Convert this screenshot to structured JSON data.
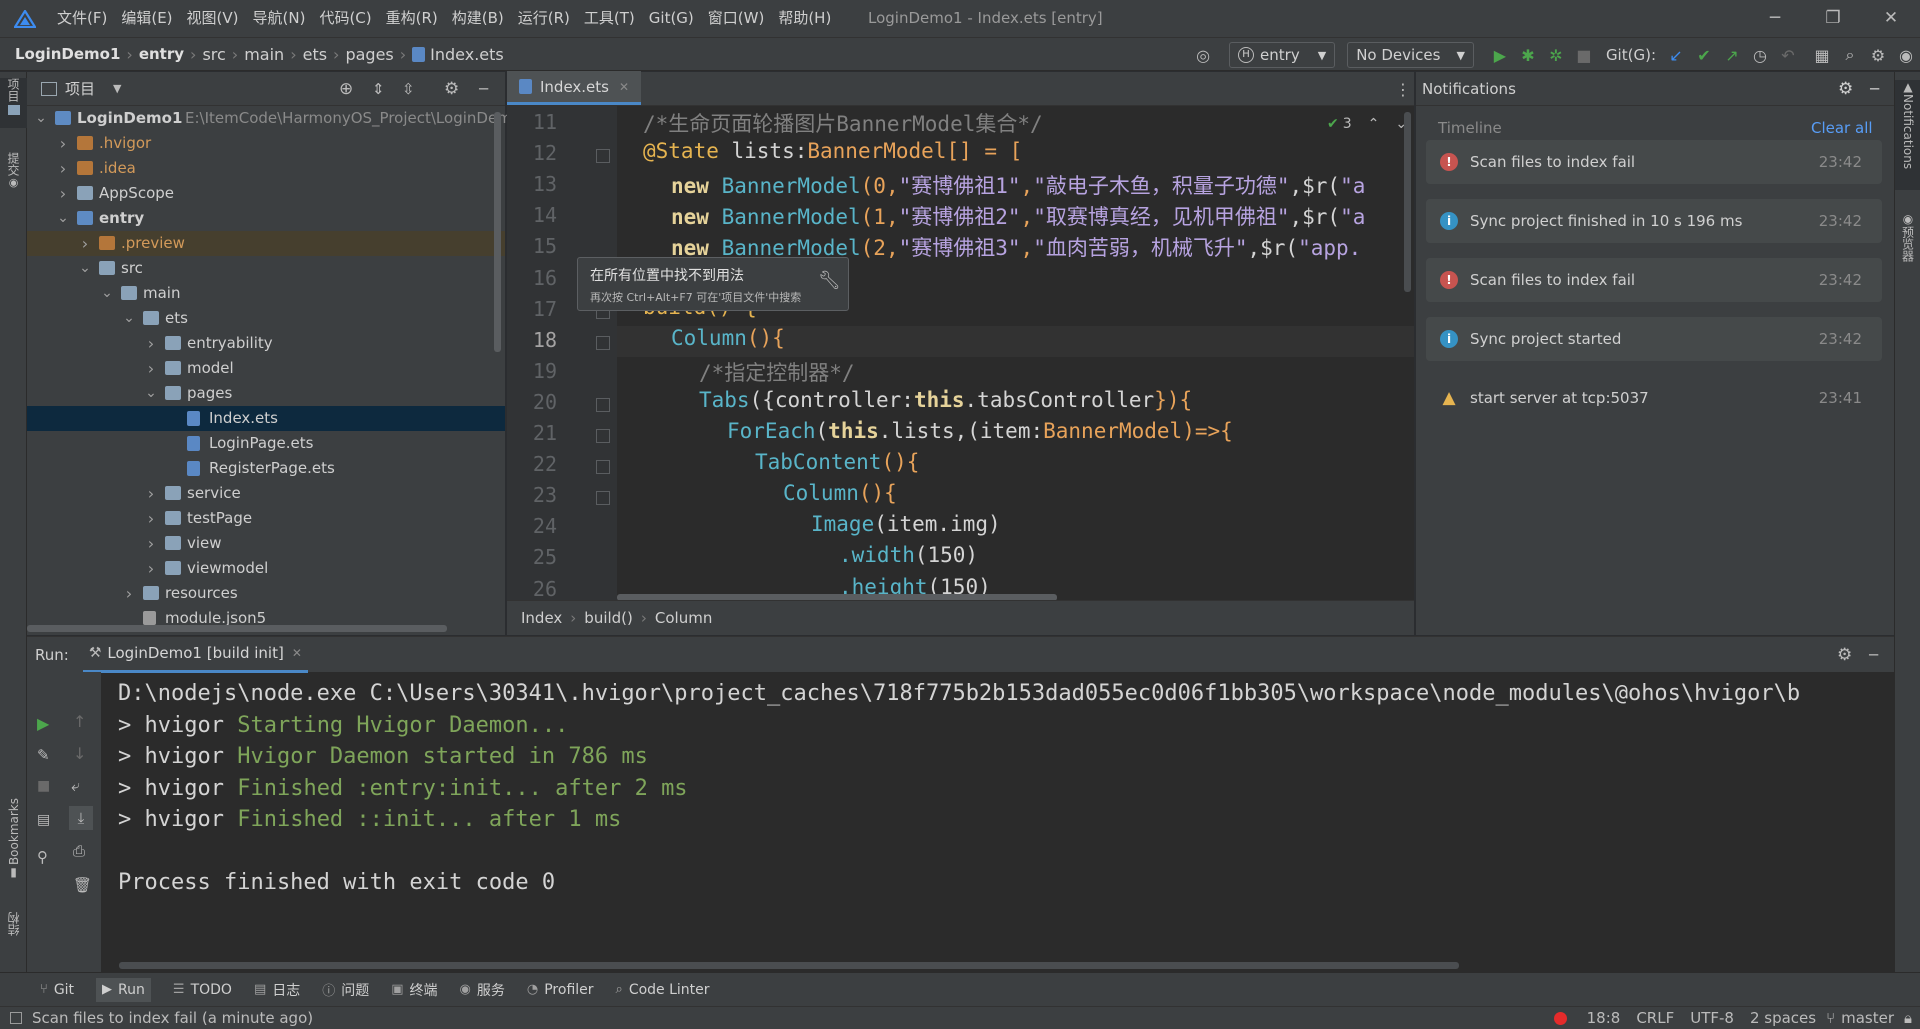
{
  "window": {
    "menu": [
      "文件(F)",
      "编辑(E)",
      "视图(V)",
      "导航(N)",
      "代码(C)",
      "重构(R)",
      "构建(B)",
      "运行(R)",
      "工具(T)",
      "Git(G)",
      "窗口(W)",
      "帮助(H)"
    ],
    "title": "LoginDemo1 - Index.ets [entry]"
  },
  "navbar": {
    "breadcrumb": [
      "LoginDemo1",
      "entry",
      "src",
      "main",
      "ets",
      "pages",
      "Index.ets"
    ],
    "module_combo": "entry",
    "device_combo": "No Devices",
    "git_label": "Git(G):"
  },
  "left_strip": {
    "project_label": "项目",
    "commit_label": "提交",
    "bookmarks_label": "Bookmarks",
    "structure_label": "结构"
  },
  "right_strip": {
    "notifications_label": "Notifications",
    "preview_label": "预览器"
  },
  "project": {
    "title": "项目",
    "root_path": "E:\\ItemCode\\HarmonyOS_Project\\LoginDemo1",
    "tree": [
      {
        "label": "LoginDemo1",
        "depth": 0,
        "expanded": true,
        "kind": "module"
      },
      {
        "label": ".hvigor",
        "depth": 1,
        "expanded": false,
        "kind": "folder-orange"
      },
      {
        "label": ".idea",
        "depth": 1,
        "expanded": false,
        "kind": "folder-orange"
      },
      {
        "label": "AppScope",
        "depth": 1,
        "expanded": false,
        "kind": "folder"
      },
      {
        "label": "entry",
        "depth": 1,
        "expanded": true,
        "kind": "module"
      },
      {
        "label": ".preview",
        "depth": 2,
        "expanded": false,
        "kind": "folder-orange"
      },
      {
        "label": "src",
        "depth": 2,
        "expanded": true,
        "kind": "folder"
      },
      {
        "label": "main",
        "depth": 3,
        "expanded": true,
        "kind": "folder"
      },
      {
        "label": "ets",
        "depth": 4,
        "expanded": true,
        "kind": "folder"
      },
      {
        "label": "entryability",
        "depth": 5,
        "expanded": false,
        "kind": "folder"
      },
      {
        "label": "model",
        "depth": 5,
        "expanded": false,
        "kind": "folder"
      },
      {
        "label": "pages",
        "depth": 5,
        "expanded": true,
        "kind": "folder"
      },
      {
        "label": "Index.ets",
        "depth": 6,
        "kind": "file"
      },
      {
        "label": "LoginPage.ets",
        "depth": 6,
        "kind": "file"
      },
      {
        "label": "RegisterPage.ets",
        "depth": 6,
        "kind": "file"
      },
      {
        "label": "service",
        "depth": 5,
        "expanded": false,
        "kind": "folder"
      },
      {
        "label": "testPage",
        "depth": 5,
        "expanded": false,
        "kind": "folder"
      },
      {
        "label": "view",
        "depth": 5,
        "expanded": false,
        "kind": "folder"
      },
      {
        "label": "viewmodel",
        "depth": 5,
        "expanded": false,
        "kind": "folder"
      },
      {
        "label": "resources",
        "depth": 4,
        "expanded": false,
        "kind": "folder"
      },
      {
        "label": "module.json5",
        "depth": 4,
        "kind": "json"
      }
    ]
  },
  "editor": {
    "tab": "Index.ets",
    "inspection_count": "3",
    "lines": [
      "11",
      "12",
      "13",
      "14",
      "15",
      "16",
      "17",
      "18",
      "19",
      "20",
      "21",
      "22",
      "23",
      "24",
      "25",
      "26"
    ],
    "current_line": "18",
    "code": {
      "l11": "/*生命页面轮播图片BannerModel集合*/",
      "l12a": "@State",
      "l12b": " lists:",
      "l12c": "BannerModel",
      "l12d": "[] = [",
      "l13a": "new ",
      "l13b": "BannerModel",
      "l13c": "(0,",
      "l13d": "\"赛博佛祖1\"",
      "l13e": ",",
      "l13f": "\"敲电子木鱼，积量子功德\"",
      "l13g": ",$r(",
      "l13h": "\"a",
      "l14a": "new ",
      "l14b": "BannerModel",
      "l14c": "(1,",
      "l14d": "\"赛博佛祖2\"",
      "l14e": ",",
      "l14f": "\"取赛博真经，见机甲佛祖\"",
      "l14g": ",$r(",
      "l14h": "\"a",
      "l15a": "new ",
      "l15b": "BannerModel",
      "l15c": "(2,",
      "l15d": "\"赛博佛祖3\"",
      "l15e": ",",
      "l15f": "\"血肉苦弱，机械飞升\"",
      "l15g": ",$r(",
      "l15h": "\"app.",
      "l17": "build() {",
      "l18a": "Column",
      "l18b": "(){",
      "l19": "/*指定控制器*/",
      "l20a": "Tabs",
      "l20b": "({controller:",
      "l20c": "this",
      "l20d": ".tabsController",
      "l20e": "}){",
      "l21a": "ForEach",
      "l21b": "(",
      "l21c": "this",
      "l21d": ".lists,(item:",
      "l21e": "BannerModel",
      "l21f": ")=>{",
      "l22a": "TabContent",
      "l22b": "(){",
      "l23a": "Column",
      "l23b": "(){",
      "l24a": "Image",
      "l24b": "(item.img)",
      "l25a": ".width",
      "l25b": "(150)",
      "l26a": ".height",
      "l26b": "(150)"
    },
    "breadcrumb": [
      "Index",
      "build()",
      "Column"
    ]
  },
  "tooltip": {
    "title": "在所有位置中找不到用法",
    "hint": "再次按 Ctrl+Alt+F7 可在'项目文件'中搜索"
  },
  "notifications": {
    "title": "Notifications",
    "timeline": "Timeline",
    "clear_all": "Clear all",
    "items": [
      {
        "type": "error",
        "message": "Scan files to index fail",
        "time": "23:42"
      },
      {
        "type": "info",
        "message": "Sync project finished in 10 s 196 ms",
        "time": "23:42"
      },
      {
        "type": "error",
        "message": "Scan files to index fail",
        "time": "23:42"
      },
      {
        "type": "info",
        "message": "Sync project started",
        "time": "23:42"
      },
      {
        "type": "warning",
        "message": "start server at tcp:5037",
        "time": "23:41"
      }
    ]
  },
  "run": {
    "label": "Run:",
    "tab": "LoginDemo1 [build init]",
    "output": [
      {
        "prefix": "D:\\nodejs\\node.exe C:\\Users\\30341\\.hvigor\\project_caches\\718f775b2b153dad055ec0d06f1bb305\\workspace\\node_modules\\@ohos\\hvigor\\b",
        "rest": ""
      },
      {
        "prefix": "> hvigor ",
        "rest": "Starting Hvigor Daemon..."
      },
      {
        "prefix": "> hvigor ",
        "rest": "Hvigor Daemon started in 786 ms"
      },
      {
        "prefix": "> hvigor ",
        "rest": "Finished :entry:init... after 2 ms"
      },
      {
        "prefix": "> hvigor ",
        "rest": "Finished ::init... after 1 ms"
      },
      {
        "prefix": "",
        "rest": ""
      },
      {
        "prefix": "Process finished with exit code 0",
        "rest": ""
      }
    ]
  },
  "bottom_tabs": [
    "Git",
    "Run",
    "TODO",
    "日志",
    "问题",
    "终端",
    "服务",
    "Profiler",
    "Code Linter"
  ],
  "status": {
    "message": "Scan files to index fail (a minute ago)",
    "position": "18:8",
    "line_sep": "CRLF",
    "encoding": "UTF-8",
    "indent": "2 spaces",
    "branch": "master"
  }
}
